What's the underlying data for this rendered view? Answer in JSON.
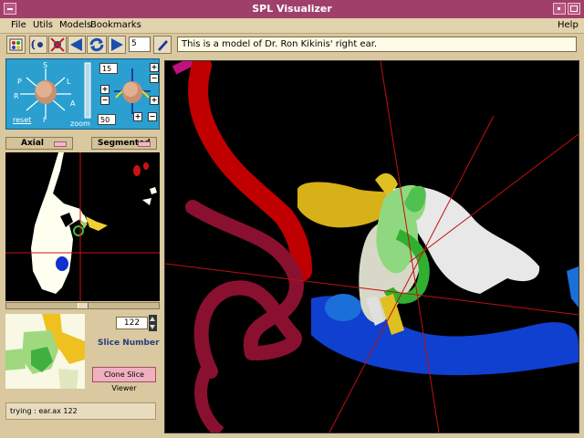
{
  "window": {
    "title": "SPL Visualizer"
  },
  "menu": {
    "items": [
      "File",
      "Utils",
      "Models",
      "Bookmarks"
    ],
    "help": "Help"
  },
  "toolbar": {
    "slice_field": "5",
    "message": "This is a model of Dr. Ron Kikinis' right ear."
  },
  "nav": {
    "labels": {
      "s": "S",
      "p": "P",
      "l": "L",
      "r": "R",
      "a": "A",
      "i": "I"
    },
    "reset": "reset",
    "zoom_label": "zoom",
    "zoom_value": "50",
    "angle_value": "15"
  },
  "dropdowns": {
    "view": "Axial",
    "mode": "Segmented"
  },
  "slice": {
    "number": "122",
    "label": "Slice Number",
    "clone": "Clone Slice Viewer"
  },
  "status": {
    "text": "trying : ear.ax 122"
  },
  "colors": {
    "title_bar": "#a0406a",
    "background": "#d9c8a0",
    "nav_panel": "#2a9fd0",
    "clone_button": "#f0b0c0"
  }
}
